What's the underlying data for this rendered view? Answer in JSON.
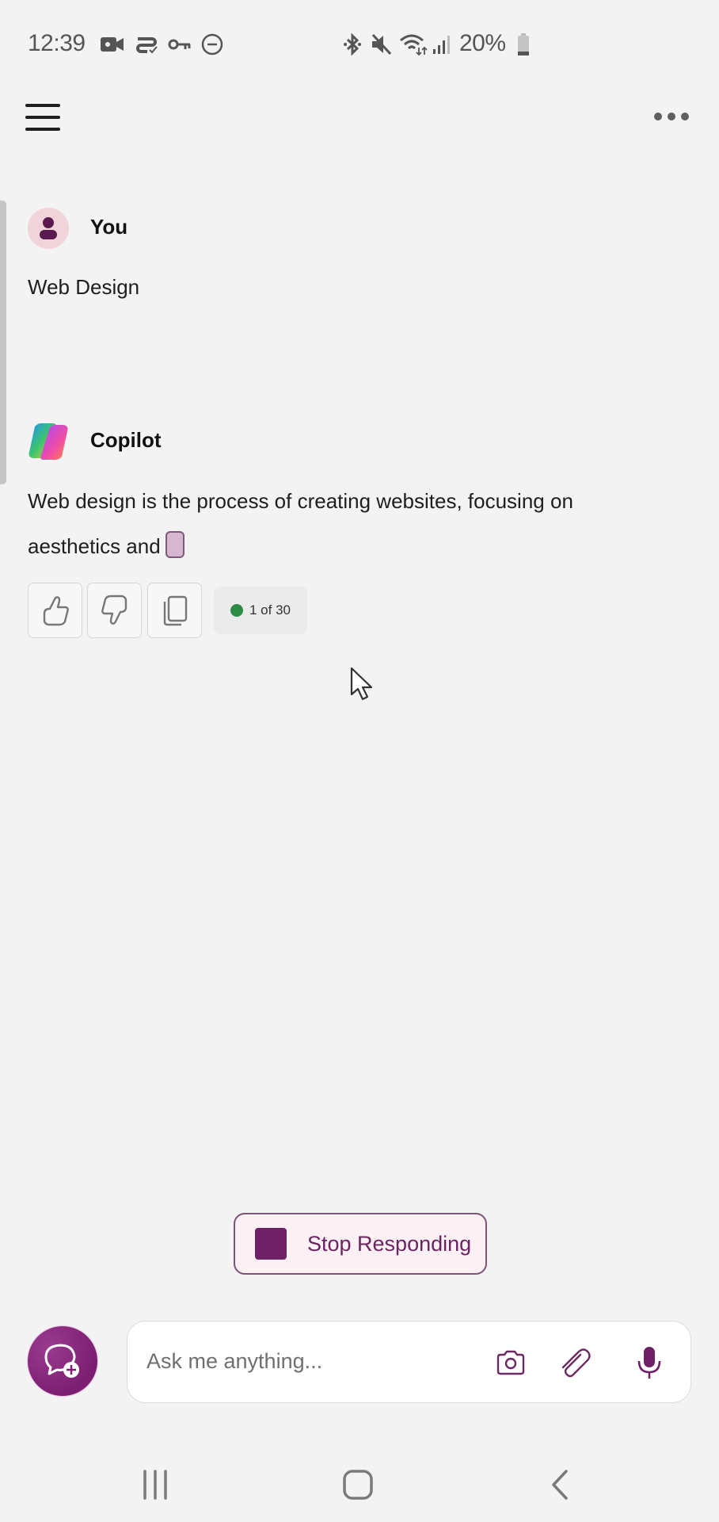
{
  "status_bar": {
    "time": "12:39",
    "left_icons": [
      "video-call-icon",
      "wallet-check-icon",
      "vpn-key-icon",
      "do-not-disturb-icon"
    ],
    "right_icons": [
      "bluetooth-icon",
      "mute-icon",
      "wifi-icon",
      "signal-icon"
    ],
    "battery_percent": "20%",
    "battery_level": 0.2
  },
  "header": {
    "menu_icon": "hamburger-menu-icon",
    "more_icon": "more-options-icon"
  },
  "conversation": {
    "user_message": {
      "author": "You",
      "text": "Web Design"
    },
    "copilot_message": {
      "author": "Copilot",
      "text_line1": "Web design is the process of creating websites, focusing on",
      "text_line2": "aesthetics and"
    },
    "feedback": {
      "like_icon": "thumbs-up-icon",
      "dislike_icon": "thumbs-down-icon",
      "copy_icon": "copy-icon",
      "turn_counter": "1 of 30",
      "turn_status_color": "#2e8b43"
    }
  },
  "stop_button": {
    "label": "Stop Responding"
  },
  "composer": {
    "placeholder": "Ask me anything...",
    "value": "",
    "icons": [
      "new-chat-icon",
      "camera-icon",
      "paperclip-icon",
      "microphone-icon"
    ]
  },
  "nav_bar": {
    "buttons": [
      "recent-apps",
      "home",
      "back"
    ]
  },
  "colors": {
    "accent": "#6e2165",
    "background": "#f3f3f3"
  }
}
